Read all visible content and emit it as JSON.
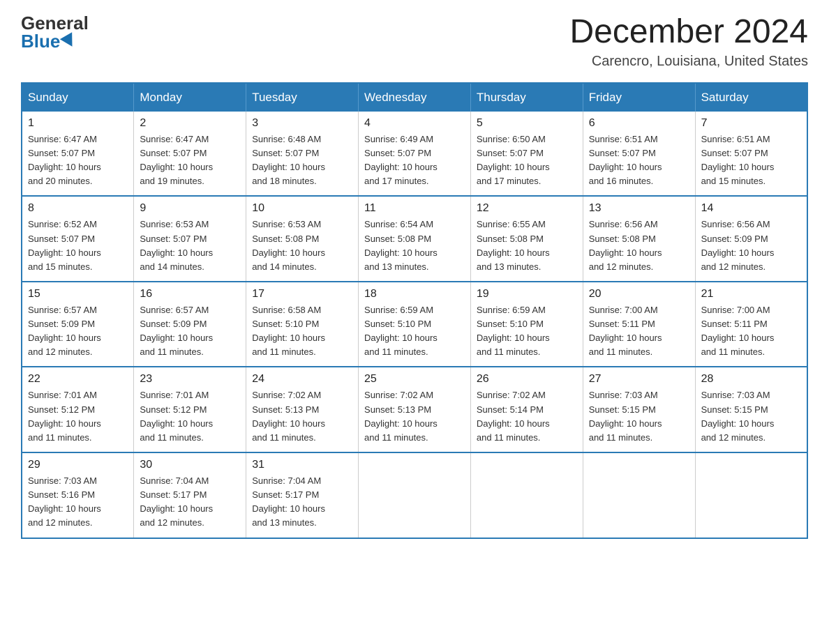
{
  "header": {
    "logo_general": "General",
    "logo_blue": "Blue",
    "month_year": "December 2024",
    "location": "Carencro, Louisiana, United States"
  },
  "days_of_week": [
    "Sunday",
    "Monday",
    "Tuesday",
    "Wednesday",
    "Thursday",
    "Friday",
    "Saturday"
  ],
  "weeks": [
    [
      {
        "day": 1,
        "sunrise": "6:47 AM",
        "sunset": "5:07 PM",
        "daylight": "10 hours and 20 minutes."
      },
      {
        "day": 2,
        "sunrise": "6:47 AM",
        "sunset": "5:07 PM",
        "daylight": "10 hours and 19 minutes."
      },
      {
        "day": 3,
        "sunrise": "6:48 AM",
        "sunset": "5:07 PM",
        "daylight": "10 hours and 18 minutes."
      },
      {
        "day": 4,
        "sunrise": "6:49 AM",
        "sunset": "5:07 PM",
        "daylight": "10 hours and 17 minutes."
      },
      {
        "day": 5,
        "sunrise": "6:50 AM",
        "sunset": "5:07 PM",
        "daylight": "10 hours and 17 minutes."
      },
      {
        "day": 6,
        "sunrise": "6:51 AM",
        "sunset": "5:07 PM",
        "daylight": "10 hours and 16 minutes."
      },
      {
        "day": 7,
        "sunrise": "6:51 AM",
        "sunset": "5:07 PM",
        "daylight": "10 hours and 15 minutes."
      }
    ],
    [
      {
        "day": 8,
        "sunrise": "6:52 AM",
        "sunset": "5:07 PM",
        "daylight": "10 hours and 15 minutes."
      },
      {
        "day": 9,
        "sunrise": "6:53 AM",
        "sunset": "5:07 PM",
        "daylight": "10 hours and 14 minutes."
      },
      {
        "day": 10,
        "sunrise": "6:53 AM",
        "sunset": "5:08 PM",
        "daylight": "10 hours and 14 minutes."
      },
      {
        "day": 11,
        "sunrise": "6:54 AM",
        "sunset": "5:08 PM",
        "daylight": "10 hours and 13 minutes."
      },
      {
        "day": 12,
        "sunrise": "6:55 AM",
        "sunset": "5:08 PM",
        "daylight": "10 hours and 13 minutes."
      },
      {
        "day": 13,
        "sunrise": "6:56 AM",
        "sunset": "5:08 PM",
        "daylight": "10 hours and 12 minutes."
      },
      {
        "day": 14,
        "sunrise": "6:56 AM",
        "sunset": "5:09 PM",
        "daylight": "10 hours and 12 minutes."
      }
    ],
    [
      {
        "day": 15,
        "sunrise": "6:57 AM",
        "sunset": "5:09 PM",
        "daylight": "10 hours and 12 minutes."
      },
      {
        "day": 16,
        "sunrise": "6:57 AM",
        "sunset": "5:09 PM",
        "daylight": "10 hours and 11 minutes."
      },
      {
        "day": 17,
        "sunrise": "6:58 AM",
        "sunset": "5:10 PM",
        "daylight": "10 hours and 11 minutes."
      },
      {
        "day": 18,
        "sunrise": "6:59 AM",
        "sunset": "5:10 PM",
        "daylight": "10 hours and 11 minutes."
      },
      {
        "day": 19,
        "sunrise": "6:59 AM",
        "sunset": "5:10 PM",
        "daylight": "10 hours and 11 minutes."
      },
      {
        "day": 20,
        "sunrise": "7:00 AM",
        "sunset": "5:11 PM",
        "daylight": "10 hours and 11 minutes."
      },
      {
        "day": 21,
        "sunrise": "7:00 AM",
        "sunset": "5:11 PM",
        "daylight": "10 hours and 11 minutes."
      }
    ],
    [
      {
        "day": 22,
        "sunrise": "7:01 AM",
        "sunset": "5:12 PM",
        "daylight": "10 hours and 11 minutes."
      },
      {
        "day": 23,
        "sunrise": "7:01 AM",
        "sunset": "5:12 PM",
        "daylight": "10 hours and 11 minutes."
      },
      {
        "day": 24,
        "sunrise": "7:02 AM",
        "sunset": "5:13 PM",
        "daylight": "10 hours and 11 minutes."
      },
      {
        "day": 25,
        "sunrise": "7:02 AM",
        "sunset": "5:13 PM",
        "daylight": "10 hours and 11 minutes."
      },
      {
        "day": 26,
        "sunrise": "7:02 AM",
        "sunset": "5:14 PM",
        "daylight": "10 hours and 11 minutes."
      },
      {
        "day": 27,
        "sunrise": "7:03 AM",
        "sunset": "5:15 PM",
        "daylight": "10 hours and 11 minutes."
      },
      {
        "day": 28,
        "sunrise": "7:03 AM",
        "sunset": "5:15 PM",
        "daylight": "10 hours and 12 minutes."
      }
    ],
    [
      {
        "day": 29,
        "sunrise": "7:03 AM",
        "sunset": "5:16 PM",
        "daylight": "10 hours and 12 minutes."
      },
      {
        "day": 30,
        "sunrise": "7:04 AM",
        "sunset": "5:17 PM",
        "daylight": "10 hours and 12 minutes."
      },
      {
        "day": 31,
        "sunrise": "7:04 AM",
        "sunset": "5:17 PM",
        "daylight": "10 hours and 13 minutes."
      },
      null,
      null,
      null,
      null
    ]
  ],
  "labels": {
    "sunrise": "Sunrise:",
    "sunset": "Sunset:",
    "daylight": "Daylight:"
  }
}
